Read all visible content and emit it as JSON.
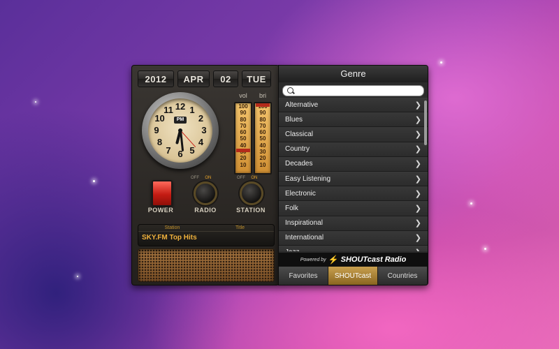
{
  "radio": {
    "date": {
      "year": "2012",
      "month": "APR",
      "day": "02",
      "weekday": "TUE"
    },
    "clock": {
      "ampm": "PM",
      "numbers": [
        "12",
        "1",
        "2",
        "3",
        "4",
        "5",
        "6",
        "7",
        "8",
        "9",
        "10",
        "11"
      ],
      "time": {
        "hour": 6,
        "minute": 29,
        "second": 23
      }
    },
    "meters": {
      "vol": {
        "label": "vol",
        "marks": [
          "100",
          "90",
          "80",
          "70",
          "60",
          "50",
          "40",
          "30",
          "20",
          "10"
        ],
        "level_percent": 30
      },
      "bri": {
        "label": "bri",
        "marks": [
          "100",
          "90",
          "80",
          "70",
          "60",
          "50",
          "40",
          "30",
          "20",
          "10"
        ],
        "level_percent": 100
      }
    },
    "controls": {
      "power_label": "POWER",
      "radio_label": "RADIO",
      "station_label": "STATION",
      "off_label": "OFF",
      "on_label": "ON"
    },
    "display": {
      "station_header": "Station",
      "title_header": "Title",
      "station_value": "SKY.FM Top Hits"
    }
  },
  "genre_panel": {
    "title": "Genre",
    "search": {
      "value": "",
      "placeholder": ""
    },
    "items": [
      {
        "label": "Alternative"
      },
      {
        "label": "Blues"
      },
      {
        "label": "Classical"
      },
      {
        "label": "Country"
      },
      {
        "label": "Decades"
      },
      {
        "label": "Easy Listening"
      },
      {
        "label": "Electronic"
      },
      {
        "label": "Folk"
      },
      {
        "label": "Inspirational"
      },
      {
        "label": "International"
      },
      {
        "label": "Jazz"
      }
    ],
    "powered_by": {
      "prefix": "Powered by",
      "brand": "SHOUTcast",
      "suffix": "Radio"
    },
    "tabs": [
      {
        "label": "Favorites",
        "active": false
      },
      {
        "label": "SHOUTcast",
        "active": true
      },
      {
        "label": "Countries",
        "active": false
      }
    ]
  },
  "colors": {
    "accent_gold": "#c9a04f",
    "power_red": "#c41c13",
    "meter_amber": "#e3a84c",
    "lcd_text": "#f0b13c"
  }
}
